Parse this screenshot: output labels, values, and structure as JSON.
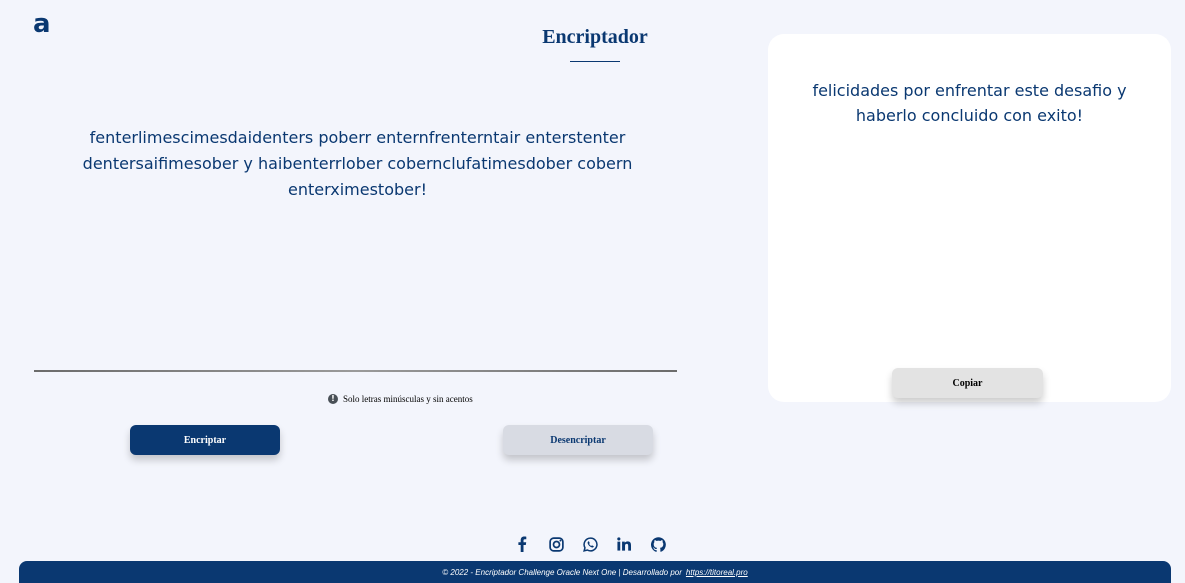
{
  "header": {
    "logo_text": "a",
    "title": "Encriptador"
  },
  "input": {
    "text": "fenterlimescimesdaidenters poberr enternfrenterntair enterstenter dentersaifimesober y haibenterrlober cobernclufatimesdober cobern enterximestober!"
  },
  "hint": {
    "icon": "info-icon",
    "text": "Solo letras minúsculas y sin acentos"
  },
  "buttons": {
    "encrypt_label": "Encriptar",
    "decrypt_label": "Desencriptar",
    "copy_label": "Copiar"
  },
  "output": {
    "text": "felicidades por enfrentar este desafio y haberlo concluido con exito!"
  },
  "social": [
    "facebook-icon",
    "instagram-icon",
    "whatsapp-icon",
    "linkedin-icon",
    "github-icon"
  ],
  "footer": {
    "text": "© 2022 - Encriptador Challenge Oracle Next One | Desarrollado por",
    "link": "https://titoreal.pro"
  },
  "colors": {
    "primary": "#0a3871",
    "background": "#f3f5fc",
    "panel": "#ffffff",
    "secondary_button": "#d8dbe3"
  }
}
